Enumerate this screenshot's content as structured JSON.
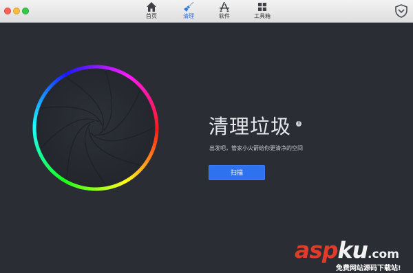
{
  "window": {
    "traffic_lights": [
      "close",
      "minimize",
      "maximize"
    ]
  },
  "nav": {
    "items": [
      {
        "label": "首页",
        "icon": "home-icon",
        "active": false
      },
      {
        "label": "清理",
        "icon": "broom-icon",
        "active": true
      },
      {
        "label": "软件",
        "icon": "app-store-icon",
        "active": false
      },
      {
        "label": "工具箱",
        "icon": "toolbox-icon",
        "active": false
      }
    ],
    "active_color": "#2a77e6"
  },
  "header": {
    "shield_icon": "shield-icon"
  },
  "main": {
    "title": "清理垃圾",
    "info_badge": "i",
    "subtitle": "出发吧，管家小火箭给你更清净的空间",
    "scan_button": "扫描",
    "accent": "#2f72ef",
    "background": "#2a2d34"
  },
  "watermark": {
    "main_red": "asp",
    "main_white": "ku",
    "domain": ".com",
    "sub": "免费网站源码下载站!"
  }
}
